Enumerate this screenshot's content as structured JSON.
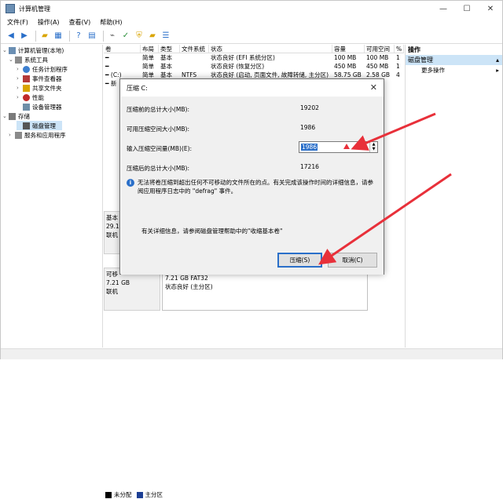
{
  "window": {
    "title": "计算机管理",
    "controls": [
      "—",
      "☐",
      "✕"
    ]
  },
  "menu": [
    "文件(F)",
    "操作(A)",
    "查看(V)",
    "帮助(H)"
  ],
  "tree": [
    {
      "label": "计算机管理(本地)",
      "level": 0,
      "expand": "⌄"
    },
    {
      "label": "系统工具",
      "level": 1,
      "expand": "⌄"
    },
    {
      "label": "任务计划程序",
      "level": 2,
      "expand": "›"
    },
    {
      "label": "事件查看器",
      "level": 2,
      "expand": "›"
    },
    {
      "label": "共享文件夹",
      "level": 2,
      "expand": "›"
    },
    {
      "label": "性能",
      "level": 2,
      "expand": "›"
    },
    {
      "label": "设备管理器",
      "level": 2,
      "expand": ""
    },
    {
      "label": "存储",
      "level": 1,
      "expand": "⌄"
    },
    {
      "label": "磁盘管理",
      "level": 2,
      "expand": "",
      "selected": true
    },
    {
      "label": "服务和应用程序",
      "level": 1,
      "expand": "›"
    }
  ],
  "table": {
    "headers": [
      "卷",
      "布局",
      "类型",
      "文件系统",
      "状态",
      "容量",
      "可用空间",
      "%"
    ],
    "rows": [
      [
        "━",
        "简单",
        "基本",
        "",
        "状态良好 (EFI 系统分区)",
        "100 MB",
        "100 MB",
        "1"
      ],
      [
        "━",
        "简单",
        "基本",
        "",
        "状态良好 (恢复分区)",
        "450 MB",
        "450 MB",
        "1"
      ],
      [
        "━ (C:)",
        "简单",
        "基本",
        "NTFS",
        "状态良好 (启动, 页面文件, 故障转储, 主分区)",
        "58.75 GB",
        "2.58 GB",
        "4"
      ],
      [
        "━ 新",
        "",
        "",
        "",
        "",
        "",
        "",
        ""
      ]
    ]
  },
  "lower": {
    "disk1": [
      "基本",
      "29.1",
      "联机"
    ],
    "disk2": [
      "可移",
      "7.21 GB",
      "联机"
    ],
    "partition": [
      "7.21 GB FAT32",
      "状态良好 (主分区)"
    ],
    "legend": [
      {
        "label": "未分配",
        "color": "#000000"
      },
      {
        "label": "主分区",
        "color": "#1c3f94"
      }
    ]
  },
  "actions": {
    "header": "操作",
    "selected": "磁盘管理",
    "items": [
      "更多操作"
    ]
  },
  "dialog": {
    "title": "压缩 C:",
    "total_before_label": "压缩前的总计大小(MB):",
    "total_before_value": "19202",
    "available_label": "可用压缩空间大小(MB):",
    "available_value": "1986",
    "input_label": "输入压缩空间量(MB)(E):",
    "input_value": "1986",
    "total_after_label": "压缩后的总计大小(MB):",
    "total_after_value": "17216",
    "info_text": "无法将卷压缩到超出任何不可移动的文件所在的点。有关完成该操作时间的详细信息，请参阅应用程序日志中的 \"defrag\" 事件。",
    "more_info": "有关详细信息，请参阅磁盘管理帮助中的\"收缩基本卷\"",
    "shrink_button": "压缩(S)",
    "cancel_button": "取消(C)"
  },
  "colors": {
    "accent": "#2a6fc9",
    "arrow": "#e8303a",
    "primary_partition": "#1c3f94"
  }
}
